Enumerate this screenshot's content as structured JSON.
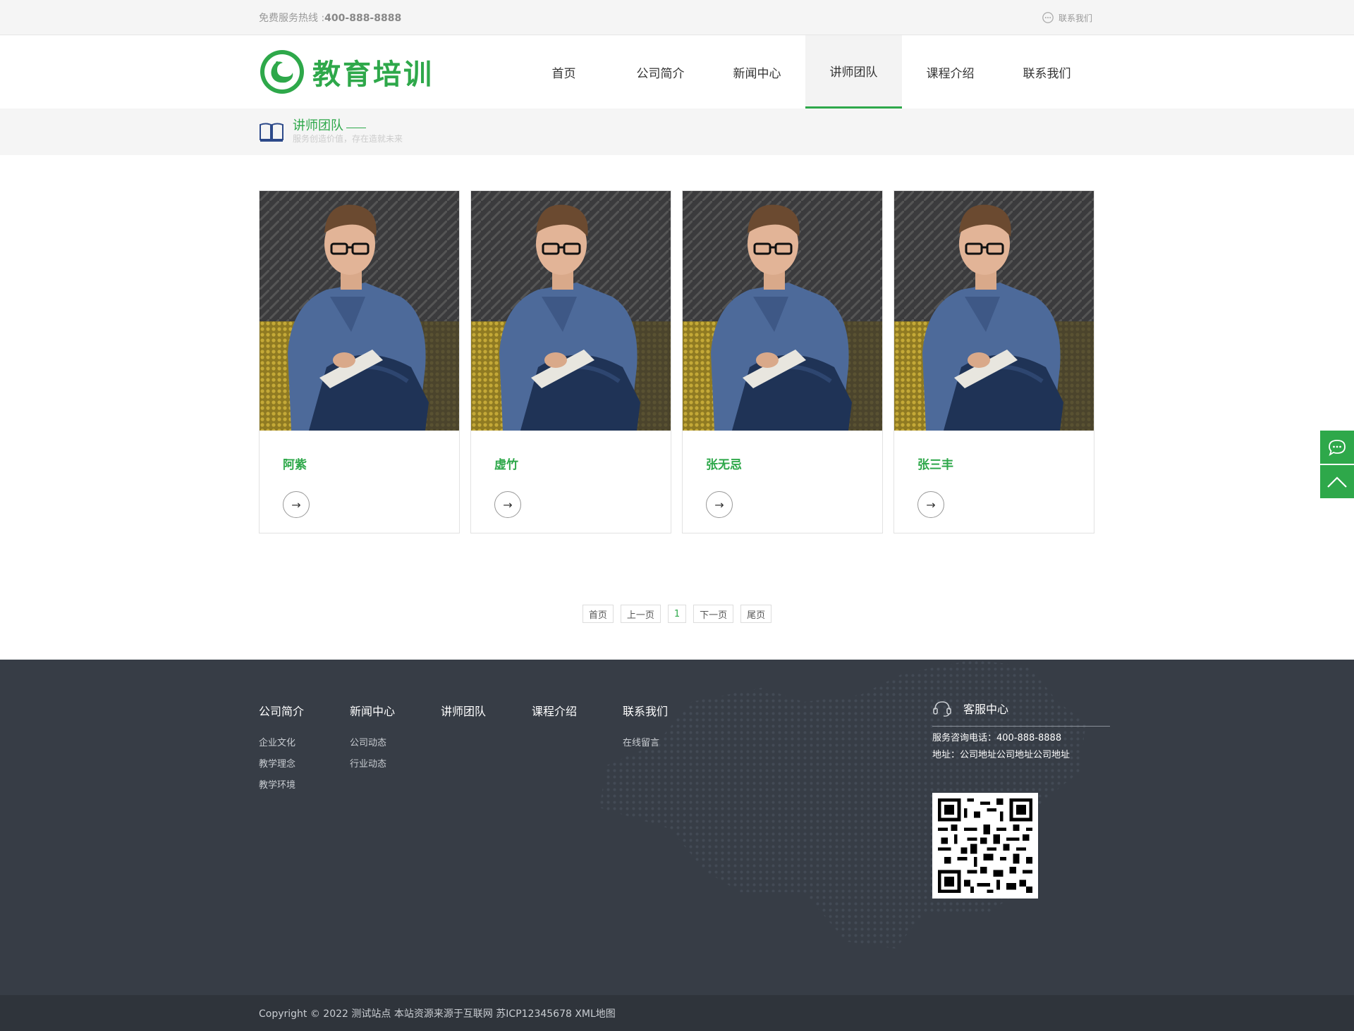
{
  "topbar": {
    "hotline_label": "免费服务热线 :",
    "hotline_number": "400-888-8888",
    "contact_label": "联系我们"
  },
  "header": {
    "logo_text": "教育培训",
    "nav": [
      "首页",
      "公司简介",
      "新闻中心",
      "讲师团队",
      "课程介绍",
      "联系我们"
    ],
    "active_nav": "讲师团队"
  },
  "banner": {
    "title": "讲师团队",
    "subtitle": "服务创造价值，存在造就未来"
  },
  "teachers": [
    {
      "name": "阿紫"
    },
    {
      "name": "虚竹"
    },
    {
      "name": "张无忌"
    },
    {
      "name": "张三丰"
    }
  ],
  "pagination": {
    "first": "首页",
    "prev": "上一页",
    "current": "1",
    "next": "下一页",
    "last": "尾页"
  },
  "footer": {
    "columns": [
      {
        "title": "公司简介",
        "links": [
          "企业文化",
          "教学理念",
          "教学环境"
        ]
      },
      {
        "title": "新闻中心",
        "links": [
          "公司动态",
          "行业动态"
        ]
      },
      {
        "title": "讲师团队",
        "links": []
      },
      {
        "title": "课程介绍",
        "links": []
      },
      {
        "title": "联系我们",
        "links": [
          "在线留言"
        ]
      }
    ],
    "service_title": "客服中心",
    "phone_line": "服务咨询电话：400-888-8888",
    "address_line": "地址：公司地址公司地址公司地址"
  },
  "copyright": "Copyright © 2022 测试站点 本站资源来源于互联网 苏ICP12345678 XML地图",
  "colors": {
    "accent": "#2ea84a",
    "footer_bg": "#373d46",
    "copyright_bg": "#2f343b"
  }
}
